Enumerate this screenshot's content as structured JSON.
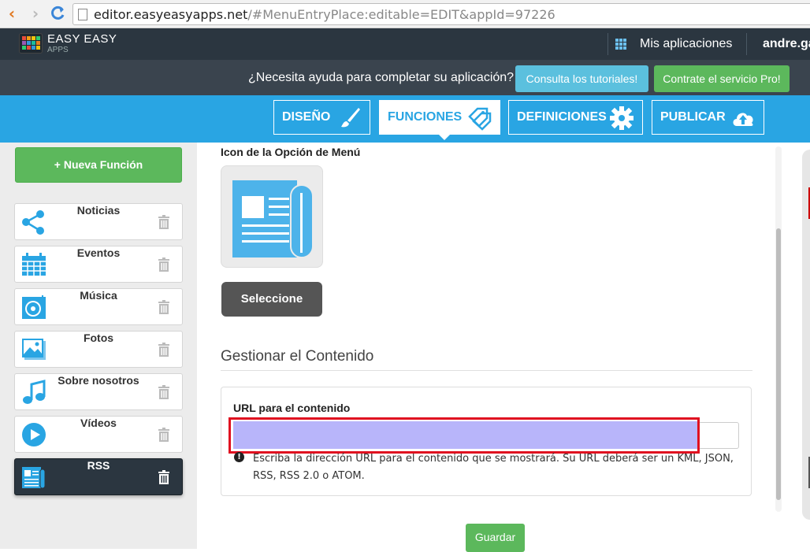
{
  "browser": {
    "back_icon": "chevron-left-icon",
    "forward_icon": "chevron-right-icon",
    "reload_icon": "reload-icon",
    "url_host": "editor.easyeasyapps.net",
    "url_rest": "/#MenuEntryPlace:editable=EDIT&appId=97226"
  },
  "header": {
    "logo_line1": "EASY EASY",
    "logo_line2": "APPS",
    "my_apps": "Mis aplicaciones",
    "user": "andre.ga"
  },
  "helpbar": {
    "question": "¿Necesita ayuda para completar su aplicación?",
    "tutorials_button": "Consulta los tutoriales!",
    "pro_button": "Contrate el servicio Pro!"
  },
  "tabs": [
    {
      "label": "DISEÑO",
      "icon": "brush-icon",
      "active": false
    },
    {
      "label": "FUNCIONES",
      "icon": "tags-icon",
      "active": true
    },
    {
      "label": "DEFINICIONES",
      "icon": "gear-icon",
      "active": false
    },
    {
      "label": "PUBLICAR",
      "icon": "cloud-upload-icon",
      "active": false
    }
  ],
  "sidebar": {
    "new_button": "Nueva Función",
    "items": [
      {
        "label": "Noticias",
        "icon": "share-icon"
      },
      {
        "label": "Eventos",
        "icon": "calendar-icon"
      },
      {
        "label": "Música",
        "icon": "music-disc-icon"
      },
      {
        "label": "Fotos",
        "icon": "photos-icon"
      },
      {
        "label": "Sobre nosotros",
        "icon": "music-note-icon"
      },
      {
        "label": "Vídeos",
        "icon": "play-icon"
      },
      {
        "label": "RSS",
        "icon": "newspaper-icon",
        "active": true
      }
    ]
  },
  "main": {
    "icon_title": "Icon de la Opción de Menú",
    "select_button": "Seleccione",
    "section_title": "Gestionar el Contenido",
    "url_label": "URL para el contenido",
    "url_value": "",
    "help_text": "Escriba la dirección URL para el contenido que se mostrará. Su URL deberá ser un KML, JSON, RSS, RSS 2.0 o ATOM.",
    "save_button": "Guardar"
  },
  "colors": {
    "accent_blue": "#29a5e3",
    "dark_header": "#2b3640",
    "green": "#5cb85c",
    "info_blue": "#5bc0de",
    "highlight": "#b8b5fa",
    "highlight_border": "#e01020"
  }
}
